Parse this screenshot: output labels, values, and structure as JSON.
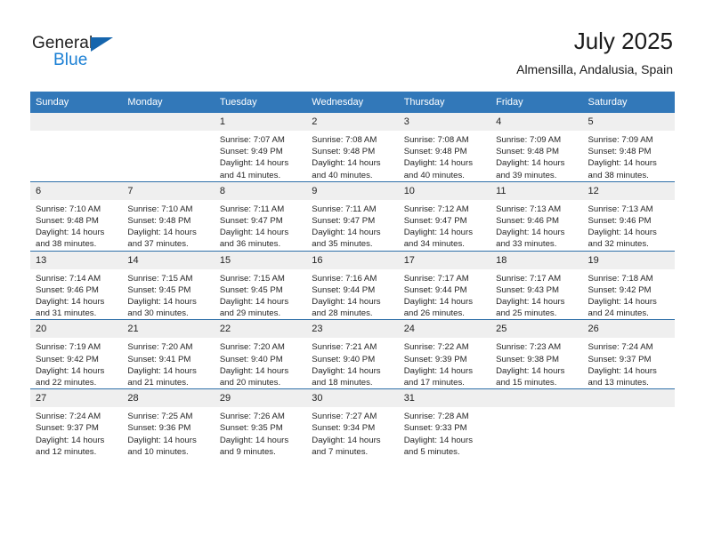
{
  "brand": {
    "name_part1": "General",
    "name_part2": "Blue"
  },
  "header": {
    "title": "July 2025",
    "location": "Almensilla, Andalusia, Spain"
  },
  "colors": {
    "header_blue": "#3278b9",
    "row_divider": "#2e6fa8",
    "daynum_band": "#efefef",
    "logo_blue": "#1a7fd4",
    "logo_triangle": "#1565ad"
  },
  "weekday_headers": [
    "Sunday",
    "Monday",
    "Tuesday",
    "Wednesday",
    "Thursday",
    "Friday",
    "Saturday"
  ],
  "weeks": [
    [
      {
        "day": "",
        "blank": true,
        "sunrise": "",
        "sunset": "",
        "daylight_line1": "",
        "daylight_line2": ""
      },
      {
        "day": "",
        "blank": true,
        "sunrise": "",
        "sunset": "",
        "daylight_line1": "",
        "daylight_line2": ""
      },
      {
        "day": "1",
        "sunrise": "Sunrise: 7:07 AM",
        "sunset": "Sunset: 9:49 PM",
        "daylight_line1": "Daylight: 14 hours",
        "daylight_line2": "and 41 minutes."
      },
      {
        "day": "2",
        "sunrise": "Sunrise: 7:08 AM",
        "sunset": "Sunset: 9:48 PM",
        "daylight_line1": "Daylight: 14 hours",
        "daylight_line2": "and 40 minutes."
      },
      {
        "day": "3",
        "sunrise": "Sunrise: 7:08 AM",
        "sunset": "Sunset: 9:48 PM",
        "daylight_line1": "Daylight: 14 hours",
        "daylight_line2": "and 40 minutes."
      },
      {
        "day": "4",
        "sunrise": "Sunrise: 7:09 AM",
        "sunset": "Sunset: 9:48 PM",
        "daylight_line1": "Daylight: 14 hours",
        "daylight_line2": "and 39 minutes."
      },
      {
        "day": "5",
        "sunrise": "Sunrise: 7:09 AM",
        "sunset": "Sunset: 9:48 PM",
        "daylight_line1": "Daylight: 14 hours",
        "daylight_line2": "and 38 minutes."
      }
    ],
    [
      {
        "day": "6",
        "sunrise": "Sunrise: 7:10 AM",
        "sunset": "Sunset: 9:48 PM",
        "daylight_line1": "Daylight: 14 hours",
        "daylight_line2": "and 38 minutes."
      },
      {
        "day": "7",
        "sunrise": "Sunrise: 7:10 AM",
        "sunset": "Sunset: 9:48 PM",
        "daylight_line1": "Daylight: 14 hours",
        "daylight_line2": "and 37 minutes."
      },
      {
        "day": "8",
        "sunrise": "Sunrise: 7:11 AM",
        "sunset": "Sunset: 9:47 PM",
        "daylight_line1": "Daylight: 14 hours",
        "daylight_line2": "and 36 minutes."
      },
      {
        "day": "9",
        "sunrise": "Sunrise: 7:11 AM",
        "sunset": "Sunset: 9:47 PM",
        "daylight_line1": "Daylight: 14 hours",
        "daylight_line2": "and 35 minutes."
      },
      {
        "day": "10",
        "sunrise": "Sunrise: 7:12 AM",
        "sunset": "Sunset: 9:47 PM",
        "daylight_line1": "Daylight: 14 hours",
        "daylight_line2": "and 34 minutes."
      },
      {
        "day": "11",
        "sunrise": "Sunrise: 7:13 AM",
        "sunset": "Sunset: 9:46 PM",
        "daylight_line1": "Daylight: 14 hours",
        "daylight_line2": "and 33 minutes."
      },
      {
        "day": "12",
        "sunrise": "Sunrise: 7:13 AM",
        "sunset": "Sunset: 9:46 PM",
        "daylight_line1": "Daylight: 14 hours",
        "daylight_line2": "and 32 minutes."
      }
    ],
    [
      {
        "day": "13",
        "sunrise": "Sunrise: 7:14 AM",
        "sunset": "Sunset: 9:46 PM",
        "daylight_line1": "Daylight: 14 hours",
        "daylight_line2": "and 31 minutes."
      },
      {
        "day": "14",
        "sunrise": "Sunrise: 7:15 AM",
        "sunset": "Sunset: 9:45 PM",
        "daylight_line1": "Daylight: 14 hours",
        "daylight_line2": "and 30 minutes."
      },
      {
        "day": "15",
        "sunrise": "Sunrise: 7:15 AM",
        "sunset": "Sunset: 9:45 PM",
        "daylight_line1": "Daylight: 14 hours",
        "daylight_line2": "and 29 minutes."
      },
      {
        "day": "16",
        "sunrise": "Sunrise: 7:16 AM",
        "sunset": "Sunset: 9:44 PM",
        "daylight_line1": "Daylight: 14 hours",
        "daylight_line2": "and 28 minutes."
      },
      {
        "day": "17",
        "sunrise": "Sunrise: 7:17 AM",
        "sunset": "Sunset: 9:44 PM",
        "daylight_line1": "Daylight: 14 hours",
        "daylight_line2": "and 26 minutes."
      },
      {
        "day": "18",
        "sunrise": "Sunrise: 7:17 AM",
        "sunset": "Sunset: 9:43 PM",
        "daylight_line1": "Daylight: 14 hours",
        "daylight_line2": "and 25 minutes."
      },
      {
        "day": "19",
        "sunrise": "Sunrise: 7:18 AM",
        "sunset": "Sunset: 9:42 PM",
        "daylight_line1": "Daylight: 14 hours",
        "daylight_line2": "and 24 minutes."
      }
    ],
    [
      {
        "day": "20",
        "sunrise": "Sunrise: 7:19 AM",
        "sunset": "Sunset: 9:42 PM",
        "daylight_line1": "Daylight: 14 hours",
        "daylight_line2": "and 22 minutes."
      },
      {
        "day": "21",
        "sunrise": "Sunrise: 7:20 AM",
        "sunset": "Sunset: 9:41 PM",
        "daylight_line1": "Daylight: 14 hours",
        "daylight_line2": "and 21 minutes."
      },
      {
        "day": "22",
        "sunrise": "Sunrise: 7:20 AM",
        "sunset": "Sunset: 9:40 PM",
        "daylight_line1": "Daylight: 14 hours",
        "daylight_line2": "and 20 minutes."
      },
      {
        "day": "23",
        "sunrise": "Sunrise: 7:21 AM",
        "sunset": "Sunset: 9:40 PM",
        "daylight_line1": "Daylight: 14 hours",
        "daylight_line2": "and 18 minutes."
      },
      {
        "day": "24",
        "sunrise": "Sunrise: 7:22 AM",
        "sunset": "Sunset: 9:39 PM",
        "daylight_line1": "Daylight: 14 hours",
        "daylight_line2": "and 17 minutes."
      },
      {
        "day": "25",
        "sunrise": "Sunrise: 7:23 AM",
        "sunset": "Sunset: 9:38 PM",
        "daylight_line1": "Daylight: 14 hours",
        "daylight_line2": "and 15 minutes."
      },
      {
        "day": "26",
        "sunrise": "Sunrise: 7:24 AM",
        "sunset": "Sunset: 9:37 PM",
        "daylight_line1": "Daylight: 14 hours",
        "daylight_line2": "and 13 minutes."
      }
    ],
    [
      {
        "day": "27",
        "sunrise": "Sunrise: 7:24 AM",
        "sunset": "Sunset: 9:37 PM",
        "daylight_line1": "Daylight: 14 hours",
        "daylight_line2": "and 12 minutes."
      },
      {
        "day": "28",
        "sunrise": "Sunrise: 7:25 AM",
        "sunset": "Sunset: 9:36 PM",
        "daylight_line1": "Daylight: 14 hours",
        "daylight_line2": "and 10 minutes."
      },
      {
        "day": "29",
        "sunrise": "Sunrise: 7:26 AM",
        "sunset": "Sunset: 9:35 PM",
        "daylight_line1": "Daylight: 14 hours",
        "daylight_line2": "and 9 minutes."
      },
      {
        "day": "30",
        "sunrise": "Sunrise: 7:27 AM",
        "sunset": "Sunset: 9:34 PM",
        "daylight_line1": "Daylight: 14 hours",
        "daylight_line2": "and 7 minutes."
      },
      {
        "day": "31",
        "sunrise": "Sunrise: 7:28 AM",
        "sunset": "Sunset: 9:33 PM",
        "daylight_line1": "Daylight: 14 hours",
        "daylight_line2": "and 5 minutes."
      },
      {
        "day": "",
        "blank": true,
        "sunrise": "",
        "sunset": "",
        "daylight_line1": "",
        "daylight_line2": ""
      },
      {
        "day": "",
        "blank": true,
        "sunrise": "",
        "sunset": "",
        "daylight_line1": "",
        "daylight_line2": ""
      }
    ]
  ]
}
